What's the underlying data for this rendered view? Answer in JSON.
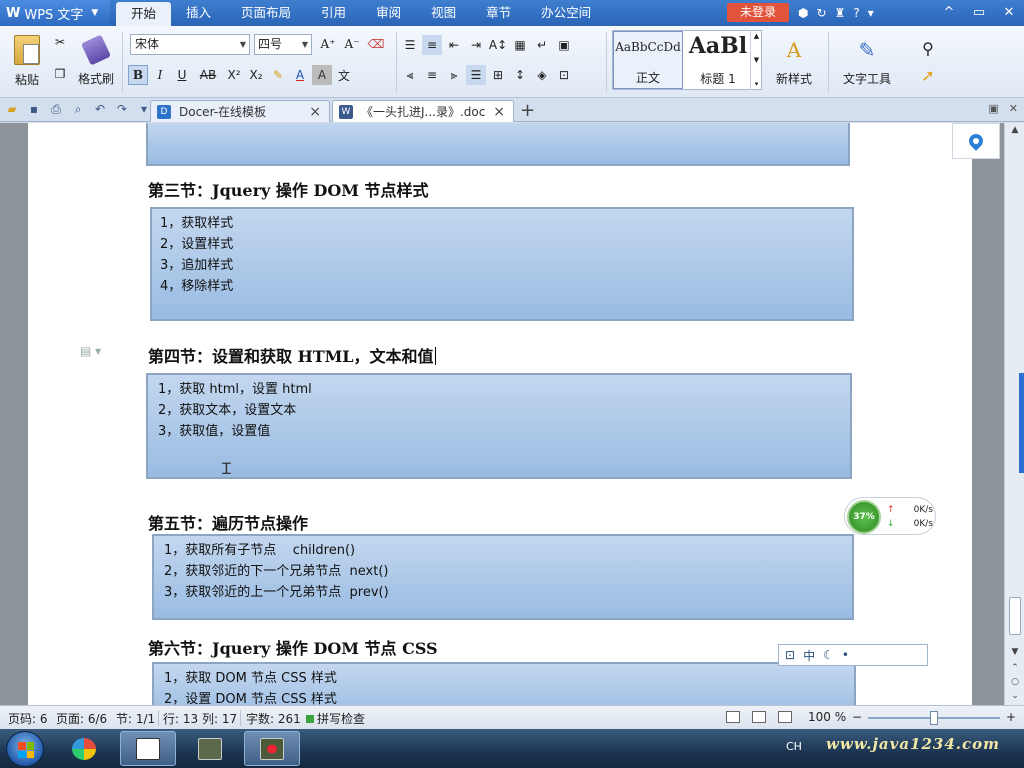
{
  "titlebar": {
    "app_logo": "W",
    "app_name": "WPS 文字",
    "tabs": [
      "开始",
      "插入",
      "页面布局",
      "引用",
      "审阅",
      "视图",
      "章节",
      "办公空间"
    ],
    "login_label": "未登录",
    "help": "?",
    "window_buttons": [
      "^",
      "▭",
      "✕"
    ]
  },
  "ribbon": {
    "paste_label": "粘贴",
    "format_painter_label": "格式刷",
    "font_name": "宋体",
    "font_size": "四号",
    "bold": "B",
    "italic": "I",
    "underline": "U",
    "strike": "AB",
    "superscript": "X²",
    "subscript": "X₂",
    "font_color_glyph": "A",
    "styles": {
      "normal_preview": "AaBbCcDd",
      "normal_label": "正文",
      "h1_preview": "AaBl",
      "h1_label": "标题 1"
    },
    "new_style_label": "新样式",
    "text_tools_label": "文字工具"
  },
  "tabstrip": {
    "tabs": [
      {
        "label": "Docer-在线模板",
        "icon": "docer-icon"
      },
      {
        "label": "《一头扎进J...录》.doc",
        "icon": "doc-icon"
      }
    ],
    "new_tab": "+"
  },
  "document": {
    "sections": [
      {
        "heading": "第三节：Jquery 操作 DOM 节点样式",
        "lines": [
          "1，获取样式",
          "2，设置样式",
          "3，追加样式",
          "4，移除样式"
        ]
      },
      {
        "heading": "第四节：设置和获取 HTML，文本和值",
        "lines": [
          "1，获取 html，设置 html",
          "2，获取文本，设置文本",
          "3，获取值，设置值"
        ]
      },
      {
        "heading": "第五节：遍历节点操作",
        "lines": [
          "1，获取所有子节点    children()",
          "2，获取邻近的下一个兄弟节点  next()",
          "3，获取邻近的上一个兄弟节点  prev()"
        ]
      },
      {
        "heading": "第六节：Jquery 操作 DOM 节点 CSS",
        "lines": [
          "1，获取 DOM 节点 CSS 样式",
          "2，设置 DOM 节点 CSS 样式"
        ]
      }
    ]
  },
  "speed_widget": {
    "percent": "37%",
    "up": "0K/s",
    "down": "0K/s"
  },
  "ime": {
    "mode": "中"
  },
  "statusbar": {
    "page_code": "页码: 6",
    "page": "页面: 6/6",
    "section": "节: 1/1",
    "row": "行: 13",
    "col": "列: 17",
    "word_count": "字数: 261",
    "spell_check": "拼写检查",
    "zoom": "100 %",
    "zoom_minus": "−",
    "zoom_plus": "+"
  },
  "taskbar": {
    "tray_lang": "CH",
    "watermark": "www.java1234.com"
  },
  "colors": {
    "titlebar": "#2e6ac0",
    "login_button": "#e2533b",
    "box_fill": "#aac7e8",
    "box_border": "#8ca5c2"
  }
}
